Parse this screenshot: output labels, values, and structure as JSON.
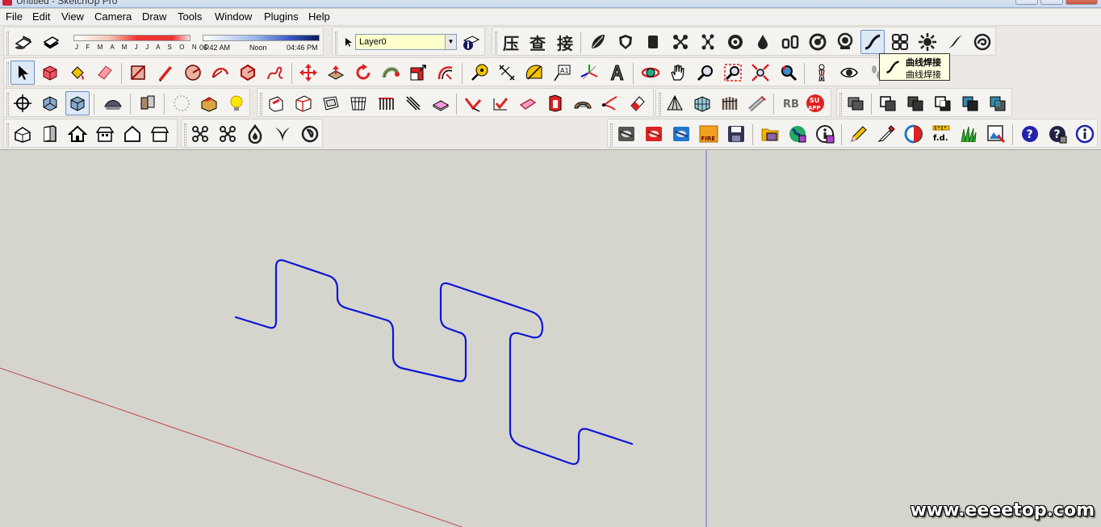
{
  "window": {
    "title": "Untitled - SketchUp Pro"
  },
  "menu": [
    "File",
    "Edit",
    "View",
    "Camera",
    "Draw",
    "Tools",
    "Window",
    "Plugins",
    "Help"
  ],
  "shadow": {
    "months": "J F M A M J J A S O N D",
    "time_start": "06:42 AM",
    "time_mid": "Noon",
    "time_end": "04:46 PM"
  },
  "layer": {
    "current": "Layer0"
  },
  "cjk_tools": [
    "压",
    "查",
    "接"
  ],
  "tooltip": {
    "title": "曲线焊接",
    "body": "曲线焊接"
  },
  "icons": {
    "row1": [
      "section-plane-icon",
      "display-section-icon",
      "compress-icon",
      "check-icon",
      "join-icon",
      "leaf-icon",
      "shield-icon",
      "box-icon",
      "nodes-icon",
      "nodes-alt-icon",
      "gear-ring-icon",
      "drop-icon",
      "glasses-icon",
      "target-icon",
      "badge-icon",
      "curve-weld-icon",
      "grid-4-icon",
      "sun-burst-icon",
      "swoosh-icon",
      "spiral-icon"
    ],
    "row2": [
      "select-icon",
      "paint-bucket-icon",
      "make-component-icon",
      "eraser-icon",
      "rectangle-icon",
      "pencil-icon",
      "circle-icon",
      "arc-icon",
      "polygon-icon",
      "freehand-icon",
      "move-icon",
      "push-pull-icon",
      "rotate-icon",
      "follow-me-icon",
      "scale-icon",
      "offset-icon",
      "tape-measure-icon",
      "dimension-icon",
      "protractor-icon",
      "text-icon",
      "axes-icon",
      "3d-text-icon",
      "orbit-icon",
      "pan-icon",
      "zoom-icon",
      "zoom-window-icon",
      "zoom-extents-icon",
      "previous-view-icon",
      "position-camera-icon",
      "look-around-icon",
      "walk-icon"
    ],
    "row3": [
      "section-icon",
      "iso-view-icon",
      "top-view-icon",
      "sandbox-icon",
      "photo-match-icon",
      "soften-icon",
      "box-fill-icon",
      "bulb-icon"
    ],
    "row4": [
      "home-iso-icon",
      "door-icon",
      "house-icon",
      "house-front-icon",
      "house-outline-icon",
      "house-side-icon",
      "nodes-4-icon",
      "nodes-x-icon",
      "flame-icon",
      "vine-icon",
      "swirl-icon"
    ],
    "right4": [
      "warehouse-icon",
      "component-red-icon",
      "component-blue-icon",
      "fire-icon",
      "save-icon",
      "folder-icon",
      "globe-icon",
      "info-purple-icon",
      "pencil-yellow-icon",
      "eyedropper-icon",
      "contrast-icon",
      "fd-icon",
      "grass-icon",
      "image-export-icon",
      "help-icon",
      "help-blue-icon",
      "info-icon"
    ]
  },
  "right_labels": {
    "fire": "FIRE",
    "fd": "f.d.",
    "su": "SU",
    "app": "APP"
  },
  "watermark": "www.eeeetop.com"
}
